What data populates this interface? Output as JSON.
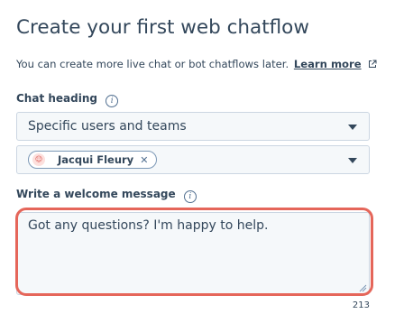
{
  "page": {
    "title": "Create your first web chatflow",
    "subtitle_text": "You can create more live chat or bot chatflows later.",
    "learn_more_label": "Learn more"
  },
  "chat_heading": {
    "label": "Chat heading",
    "info_icon": "info-icon",
    "selected": "Specific users and teams",
    "users_selected": [
      {
        "name": "Jacqui Fleury",
        "avatar_icon": "user-avatar-icon"
      }
    ]
  },
  "welcome_message": {
    "label": "Write a welcome message",
    "value": "Got any questions? I'm happy to help.",
    "char_count": "213"
  },
  "colors": {
    "text": "#33475b",
    "field_bg": "#f5f8fa",
    "field_border": "#cbd6e2",
    "highlight": "#e5665a"
  }
}
